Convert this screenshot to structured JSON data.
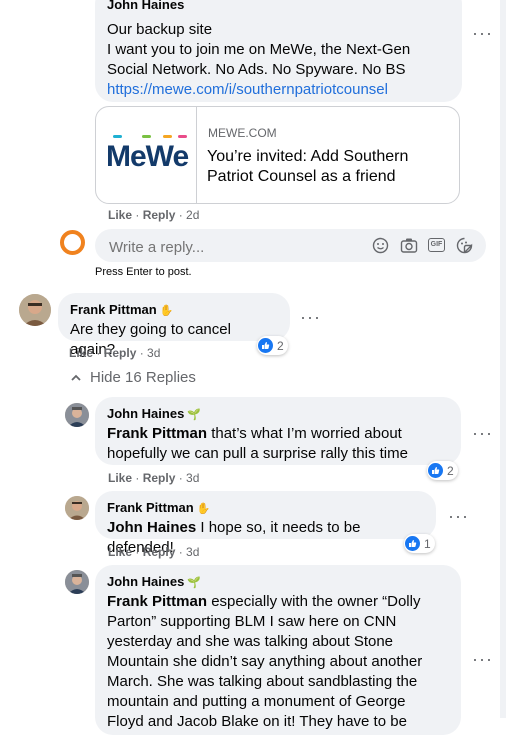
{
  "colors": {
    "accent": "#216fdb",
    "brand_like": "#1877f2",
    "bubble_bg": "#f0f2f5",
    "muted": "#65676b",
    "loading_ring": "#f0821e"
  },
  "top_comment": {
    "author": "John Haines",
    "lines": [
      "Our backup site",
      "I want you to join me on MeWe, the Next-Gen",
      "Social Network. No Ads. No Spyware. No BS"
    ],
    "link": "https://mewe.com/i/southernpatriotcounsel",
    "preview": {
      "logo_text": "MeWe",
      "domain": "MEWE.COM",
      "title_line1": "You’re invited: Add Southern",
      "title_line2": "Patriot Counsel as a friend"
    },
    "actions": {
      "like": "Like",
      "reply": "Reply",
      "time": "2d"
    }
  },
  "reply_box": {
    "placeholder": "Write a reply...",
    "hint": "Press Enter to post.",
    "icons": [
      "emoji-icon",
      "camera-icon",
      "gif-icon",
      "sticker-icon"
    ],
    "gif_label": "GIF"
  },
  "comments": [
    {
      "author": "Frank Pittman",
      "badge_icon": "hand-wave-icon",
      "text": "Are they going to cancel again?",
      "likes": "2",
      "actions": {
        "like": "Like",
        "reply": "Reply",
        "time": "3d"
      }
    }
  ],
  "hide_replies_label": "Hide 16 Replies",
  "replies": [
    {
      "author": "John Haines",
      "badge_icon": "plant-icon",
      "mention": "Frank Pittman",
      "line1": " that’s what I’m worried about",
      "line2": "hopefully we can pull a surprise rally this time",
      "likes": "2",
      "actions": {
        "like": "Like",
        "reply": "Reply",
        "time": "3d"
      }
    },
    {
      "author": "Frank Pittman",
      "badge_icon": "hand-wave-icon",
      "mention": "John Haines",
      "line1": " I hope so, it needs to be defended!",
      "likes": "1",
      "actions": {
        "like": "Like",
        "reply": "Reply",
        "time": "3d"
      }
    },
    {
      "author": "John Haines",
      "badge_icon": "plant-icon",
      "mention": "Frank Pittman",
      "lines": [
        " especially with the owner “Dolly",
        "Parton” supporting BLM I saw here on CNN",
        "yesterday and she was talking about Stone",
        "Mountain she didn’t say anything about another",
        "March. She was talking about sandblasting the",
        "mountain and putting a monument of George",
        "Floyd and Jacob Blake on it! They have to be"
      ]
    }
  ]
}
